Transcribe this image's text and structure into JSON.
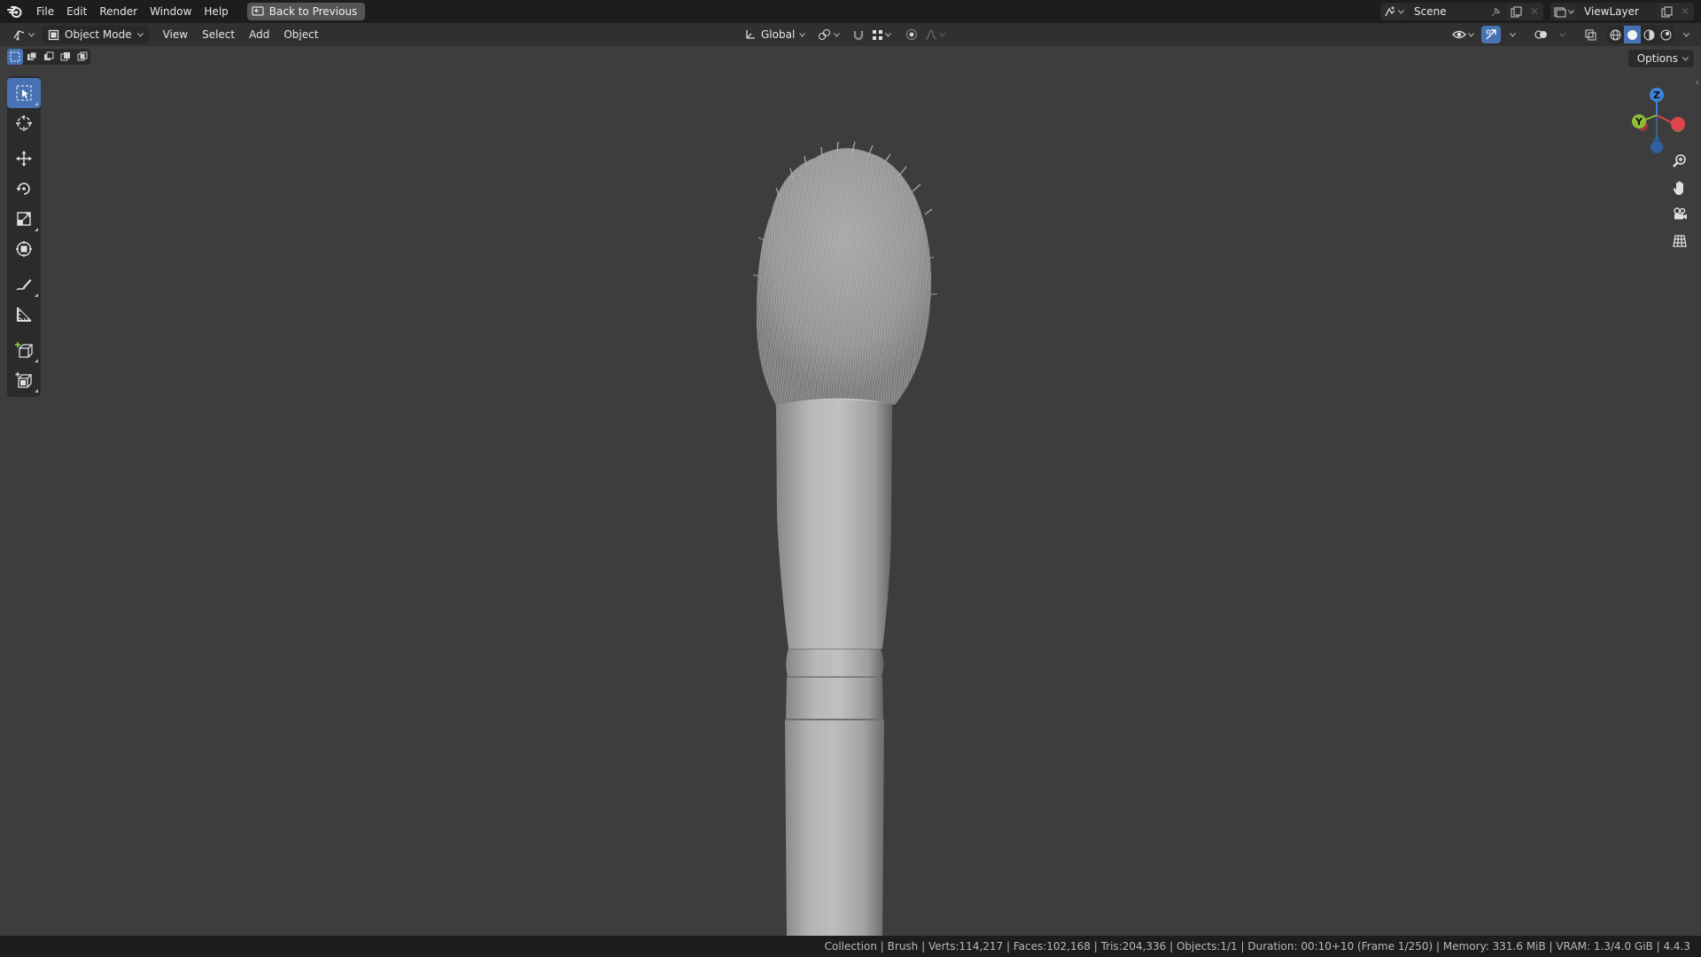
{
  "menubar": {
    "items": [
      "File",
      "Edit",
      "Render",
      "Window",
      "Help"
    ],
    "back_label": "Back to Previous",
    "scene_name": "Scene",
    "view_layer_name": "ViewLayer"
  },
  "header": {
    "mode": "Object Mode",
    "menus": [
      "View",
      "Select",
      "Add",
      "Object"
    ],
    "orientation": "Global"
  },
  "viewport": {
    "options_label": "Options",
    "gizmo_axes": {
      "x": "X",
      "y": "Y",
      "z": "Z"
    },
    "tools": [
      "select-box",
      "cursor",
      "move",
      "rotate",
      "scale",
      "transform",
      "annotate",
      "measure",
      "add-cube",
      "add-object"
    ]
  },
  "statusbar": {
    "text": "Collection | Brush | Verts:114,217 | Faces:102,168 | Tris:204,336 | Objects:1/1 | Duration: 00:10+10 (Frame 1/250) | Memory: 331.6 MiB | VRAM: 1.3/4.0 GiB | 4.4.3"
  },
  "colors": {
    "accent": "#4772b3",
    "viewport_bg": "#3d3d3d",
    "axis_x": "#e0454f",
    "axis_y": "#8bbf35",
    "axis_z": "#3e82dc"
  }
}
